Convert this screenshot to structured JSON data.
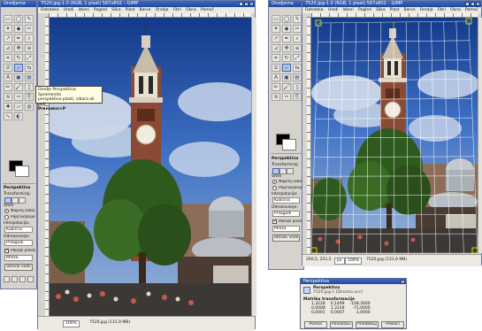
{
  "left_toolbox": {
    "title": "Orodjarna",
    "colors": {
      "fg": "#000000",
      "bg": "#ffffff"
    },
    "options_title": "Perspektiva",
    "transform_label": "Transformiraj:",
    "direction_label": "Smer",
    "direction_options": [
      "Naprej (običajno)",
      "Popravljanje (nazaj)"
    ],
    "interpolation_label": "Interpolacija:",
    "interpolation_value": "Kubična",
    "clipping_label": "Odrezovanje:",
    "clipping_value": "Prilagodi",
    "preview_label": "Pokaži predogled",
    "preview_mode_value": "Mreža",
    "grid_button": "Število vodil"
  },
  "tooltip": {
    "line1": "Orodje Perspektiva: Spremenite",
    "line2": "perspektivo plasti, izbora ali poti",
    "shortcut": "Premakni+P"
  },
  "left_image_window": {
    "title": "7520.jpg-1.0 (RGB, 1 plast) 567x802 – GIMP",
    "menu": [
      "Datoteka",
      "Uredi",
      "Izberi",
      "Pogled",
      "Slika",
      "Plast",
      "Barve",
      "Orodja",
      "Filtri",
      "Okna",
      "Pomoč"
    ],
    "zoom": "100%",
    "status": "7520.jpg (131,9 MB)"
  },
  "right_toolbox": {
    "title": "Orodjarna",
    "colors": {
      "fg": "#000000",
      "bg": "#ffffff"
    },
    "options_title": "Perspektiva",
    "transform_label": "Transformiraj:",
    "direction_label": "Smer",
    "direction_options": [
      "Naprej (običajno)",
      "Popravljanje (nazaj)"
    ],
    "interpolation_label": "Interpolacija:",
    "interpolation_value": "Kubična",
    "clipping_label": "Odrezovanje:",
    "clipping_value": "Prilagodi",
    "preview_label": "Pokaži predogled",
    "preview_mode_value": "Mreža",
    "grid_button": "Število vodil"
  },
  "right_image_window": {
    "title": "7520.jpg-1.0 (RGB, 1 plast) 567x802 – GIMP",
    "menu": [
      "Datoteka",
      "Uredi",
      "Izberi",
      "Pogled",
      "Slika",
      "Plast",
      "Barve",
      "Orodja",
      "Filtri",
      "Okna",
      "Pomoč"
    ],
    "coords": "260,5, 251,5",
    "unit": "px",
    "zoom": "100%",
    "status": "7520.jpg (131,9 MB)"
  },
  "perspective_dialog": {
    "title": "Perspektiva",
    "heading": "Perspektiva",
    "subheading": "7520.jpg-1 [Dinamo.xcx]",
    "matrix_label": "Matrika transformacije",
    "matrix": [
      [
        "1,3228",
        "0,1499",
        "-108,3000"
      ],
      [
        "0,0008",
        "1,3319",
        "-71,0000"
      ],
      [
        "0,0001",
        "0,0007",
        "1,0000"
      ]
    ],
    "buttons": [
      "Pomoč",
      "Ponastavi",
      "Preoblikuj",
      "Prekliči"
    ]
  }
}
